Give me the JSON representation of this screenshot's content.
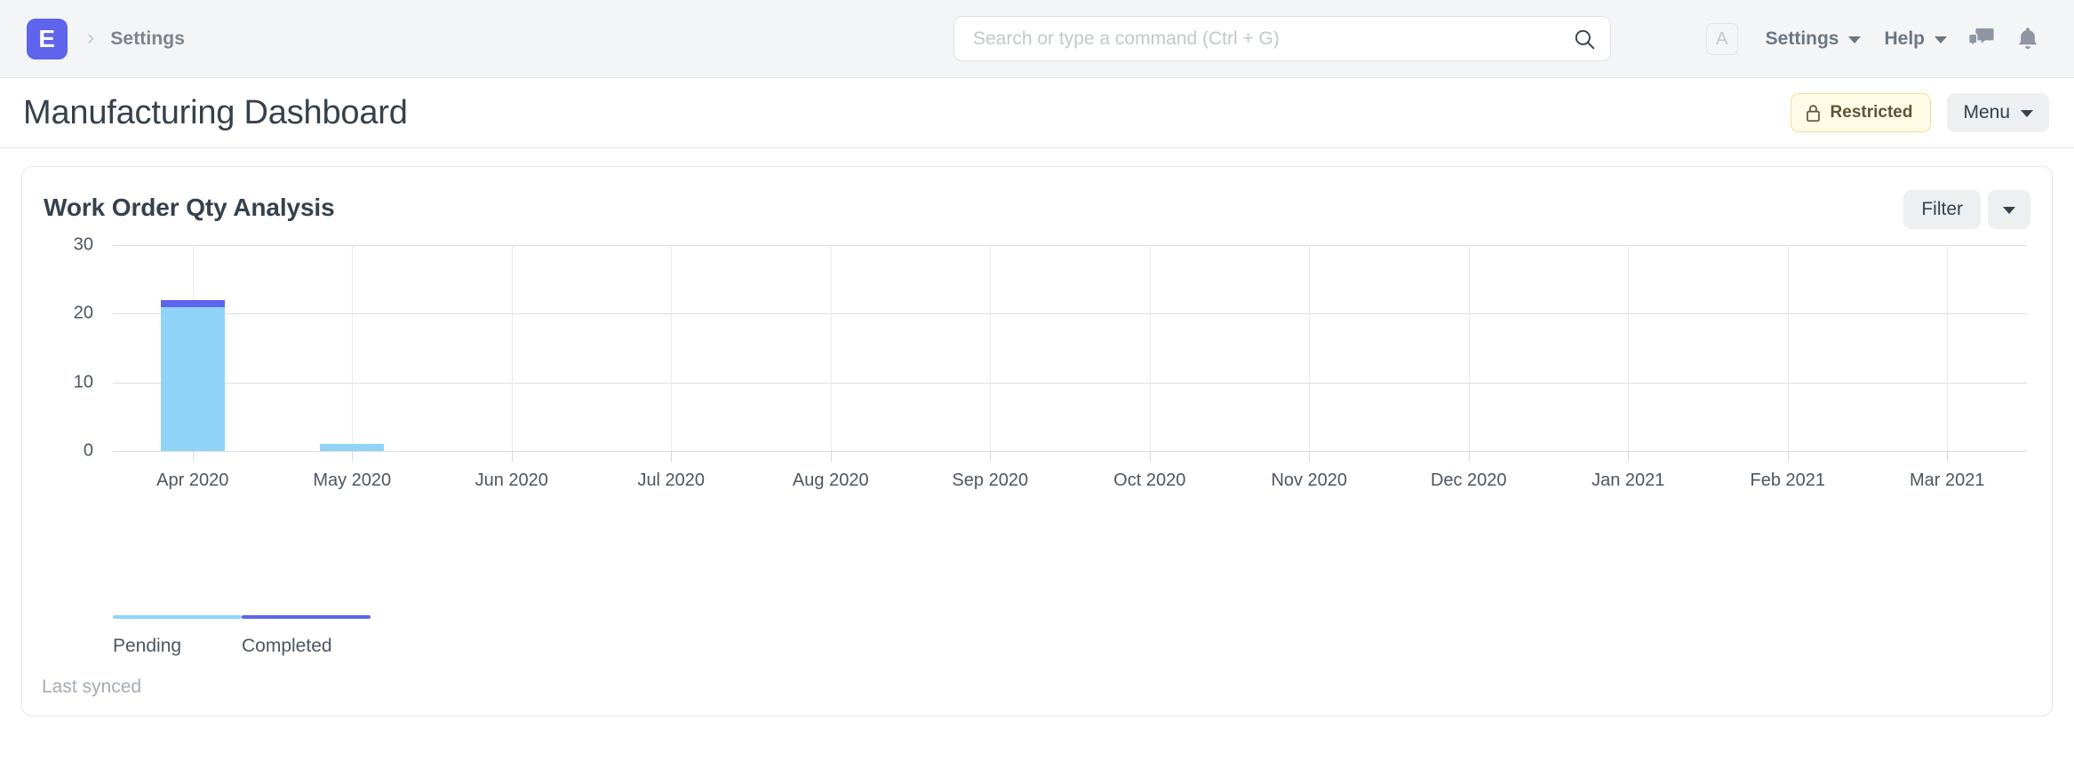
{
  "navbar": {
    "brand_initial": "E",
    "breadcrumb_separator": "›",
    "breadcrumb_label": "Settings",
    "search": {
      "placeholder": "Search or type a command (Ctrl + G)",
      "value": "",
      "icon": "search-icon"
    },
    "avatar_initial": "A",
    "settings_label": "Settings",
    "help_label": "Help",
    "chat_icon": "chat-icon",
    "notifications_icon": "bell-icon"
  },
  "page": {
    "title": "Manufacturing Dashboard",
    "restricted_label": "Restricted",
    "restricted_icon": "lock-icon",
    "menu_label": "Menu"
  },
  "card": {
    "title": "Work Order Qty Analysis",
    "filter_label": "Filter",
    "filter_caret_icon": "chevron-down-icon",
    "last_synced": "Last synced"
  },
  "colors": {
    "brand": "#5e64ec",
    "pending": "#8fd4f8",
    "completed": "#5e64ec",
    "restricted_bg": "#fffbe6",
    "restricted_border": "#f5e09a",
    "grid": "#dadee2",
    "text": "#36414c",
    "muted": "#a6acb4"
  },
  "chart_data": {
    "type": "bar",
    "stacked": true,
    "title": "Work Order Qty Analysis",
    "xlabel": "",
    "ylabel": "",
    "ylim": [
      0,
      30
    ],
    "yticks": [
      0,
      10,
      20,
      30
    ],
    "grid": true,
    "legend_position": "bottom-left",
    "categories": [
      "Apr 2020",
      "May 2020",
      "Jun 2020",
      "Jul 2020",
      "Aug 2020",
      "Sep 2020",
      "Oct 2020",
      "Nov 2020",
      "Dec 2020",
      "Jan 2021",
      "Feb 2021",
      "Mar 2021"
    ],
    "series": [
      {
        "name": "Pending",
        "color": "#8fd4f8",
        "values": [
          21,
          1,
          0,
          0,
          0,
          0,
          0,
          0,
          0,
          0,
          0,
          0
        ]
      },
      {
        "name": "Completed",
        "color": "#5e64ec",
        "values": [
          1,
          0,
          0,
          0,
          0,
          0,
          0,
          0,
          0,
          0,
          0,
          0
        ]
      }
    ]
  }
}
